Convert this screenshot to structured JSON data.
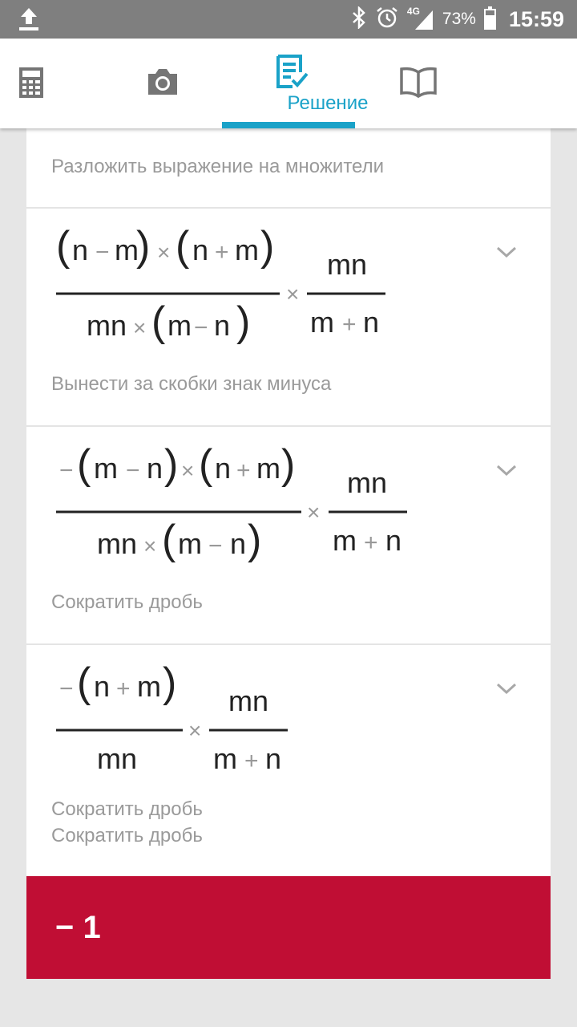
{
  "status_bar": {
    "network": "4G",
    "battery": "73%",
    "battery_level": 0.73,
    "time": "15:59"
  },
  "tabs": [
    {
      "icon": "calculator-icon"
    },
    {
      "icon": "camera-icon"
    },
    {
      "icon": "solution-icon",
      "label": "Решение",
      "active": true
    },
    {
      "icon": "book-icon"
    }
  ],
  "accent_color": "#1aa2c8",
  "result_color": "#c00e34",
  "steps": [
    {
      "label": "Разложить выражение на множители"
    },
    {
      "expression": {
        "numerator": [
          "(",
          "n",
          "−",
          "m",
          ")",
          "×",
          "(",
          "n",
          "+",
          "m",
          ")"
        ],
        "denominator": [
          "mn",
          "×",
          "(",
          "m",
          "−",
          "n",
          ")"
        ],
        "times": "×",
        "fraction2": {
          "numerator": "mn",
          "denominator": [
            "m",
            "+",
            "n"
          ]
        }
      },
      "label": "Вынести за скобки знак минуса"
    },
    {
      "expression": {
        "numerator": [
          "−",
          "(",
          "m",
          "−",
          "n",
          ")",
          "×",
          "(",
          "n",
          "+",
          "m",
          ")"
        ],
        "denominator": [
          "mn",
          "×",
          "(",
          "m",
          "−",
          "n",
          ")"
        ],
        "times": "×",
        "fraction2": {
          "numerator": "mn",
          "denominator": [
            "m",
            "+",
            "n"
          ]
        }
      },
      "label": "Сократить дробь"
    },
    {
      "expression": {
        "numerator": [
          "−",
          "(",
          "n",
          "+",
          "m",
          ")"
        ],
        "denominator": [
          "mn"
        ],
        "times": "×",
        "fraction2": {
          "numerator": "mn",
          "denominator": [
            "m",
            "+",
            "n"
          ]
        }
      },
      "labels": [
        "Сократить дробь",
        "Сократить дробь"
      ]
    }
  ],
  "result": "− 1"
}
